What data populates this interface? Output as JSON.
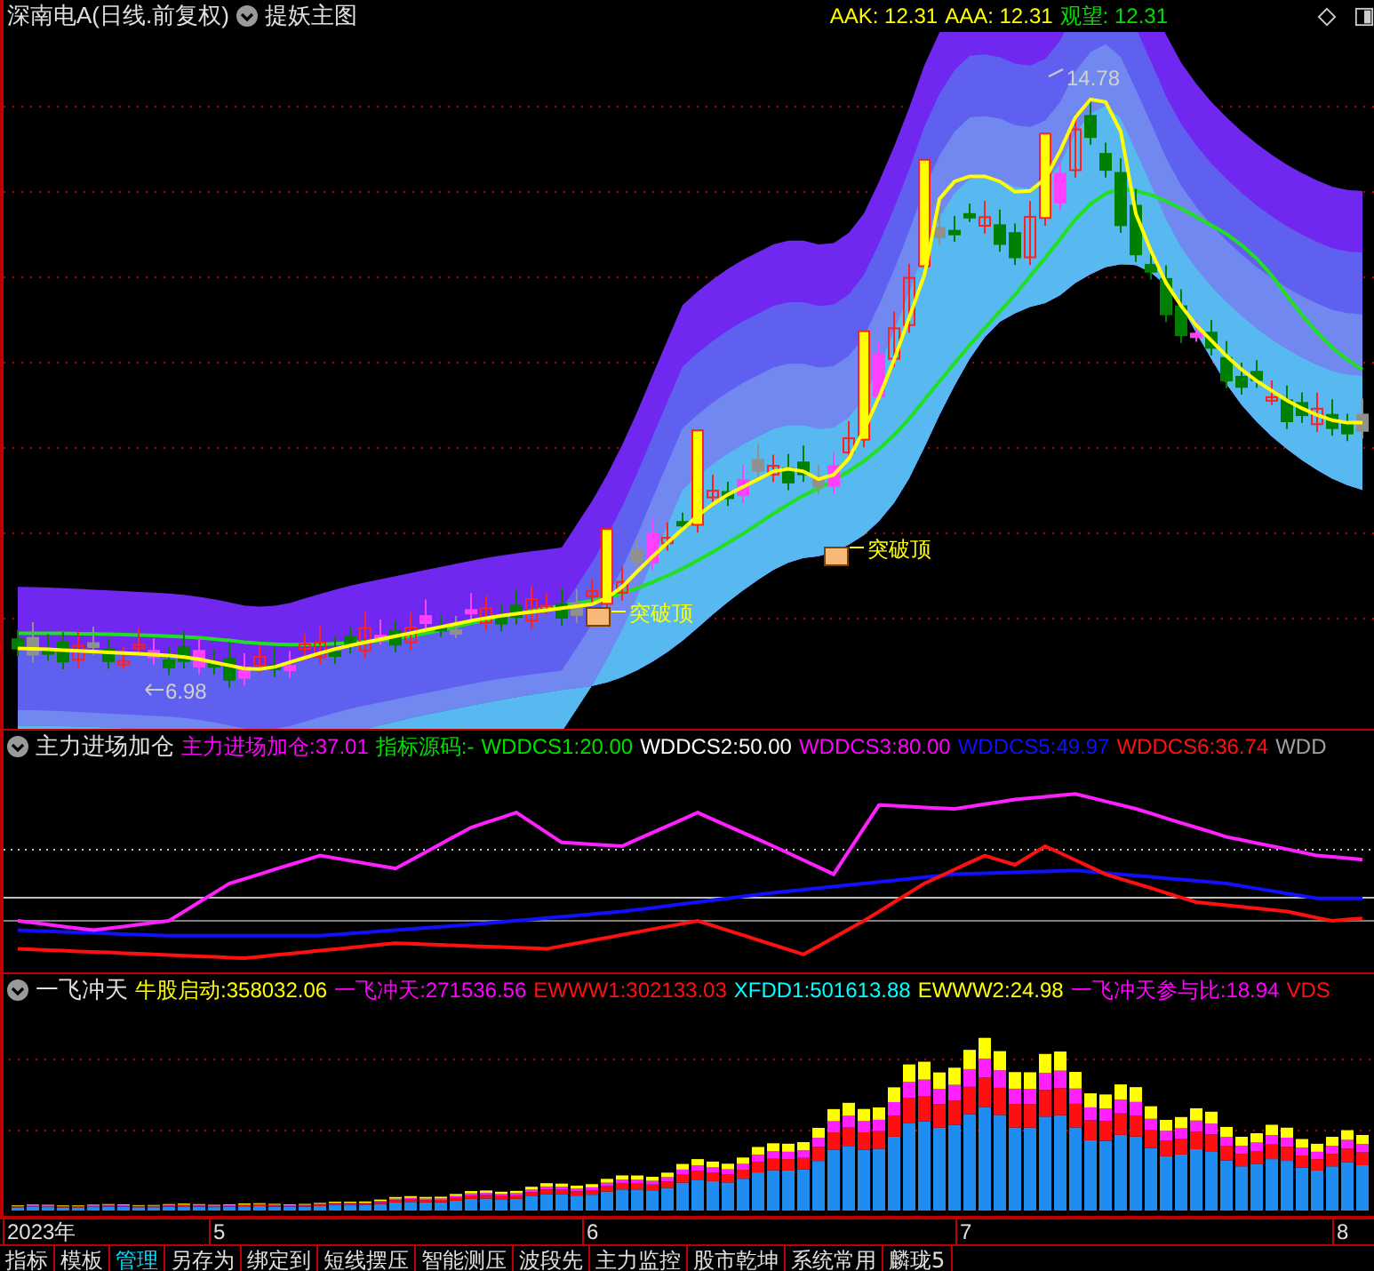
{
  "main_chart": {
    "title": "深南电A(日线.前复权)",
    "indicator": "提妖主图",
    "readings": [
      {
        "label": "AAK:",
        "value": "12.31",
        "color": "#ffff00"
      },
      {
        "label": "AAA:",
        "value": "12.31",
        "color": "#ffff00"
      },
      {
        "label": "观望:",
        "value": "12.31",
        "color": "#00e000"
      }
    ],
    "high_label": "14.78",
    "low_label": "6.98",
    "signals": [
      "突破顶",
      "突破顶"
    ]
  },
  "sub_chart_1": {
    "title": "主力进场加仓",
    "readings": [
      {
        "label": "主力进场加仓:",
        "value": "37.01",
        "color": "#ff00ff"
      },
      {
        "label": "指标源码:",
        "value": "-",
        "color": "#00e000"
      },
      {
        "label": "WDDCS1:",
        "value": "20.00",
        "color": "#00e000"
      },
      {
        "label": "WDDCS2:",
        "value": "50.00",
        "color": "#ffffff"
      },
      {
        "label": "WDDCS3:",
        "value": "80.00",
        "color": "#ff00ff"
      },
      {
        "label": "WDDCS5:",
        "value": "49.97",
        "color": "#1010ff"
      },
      {
        "label": "WDDCS6:",
        "value": "36.74",
        "color": "#ff1010"
      },
      {
        "label": "WDD",
        "color": "#a0a0a0"
      }
    ]
  },
  "sub_chart_2": {
    "title": "一飞冲天",
    "readings": [
      {
        "label": "牛股启动:",
        "value": "358032.06",
        "color": "#ffff00"
      },
      {
        "label": "一飞冲天:",
        "value": "271536.56",
        "color": "#ff00ff"
      },
      {
        "label": "EWWW1:",
        "value": "302133.03",
        "color": "#ff1010"
      },
      {
        "label": "XFDD1:",
        "value": "501613.88",
        "color": "#00ffff"
      },
      {
        "label": "EWWW2:",
        "value": "24.98",
        "color": "#ffff00"
      },
      {
        "label": "一飞冲天参与比:",
        "value": "18.94",
        "color": "#ff00ff"
      },
      {
        "label": "VDS",
        "color": "#ff1010"
      }
    ]
  },
  "date_axis": [
    "2023年",
    "5",
    "6",
    "7",
    "8"
  ],
  "tabs": [
    {
      "label": "指标",
      "selected": false
    },
    {
      "label": "模板",
      "selected": false
    },
    {
      "label": "管理",
      "selected": true
    },
    {
      "label": "另存为",
      "selected": false
    },
    {
      "label": "绑定到",
      "selected": false
    },
    {
      "label": "短线摆压",
      "selected": false
    },
    {
      "label": "智能测压",
      "selected": false
    },
    {
      "label": "波段先",
      "selected": false
    },
    {
      "label": "主力监控",
      "selected": false
    },
    {
      "label": "股市乾坤",
      "selected": false
    },
    {
      "label": "系统常用",
      "selected": false
    },
    {
      "label": "麟珑5",
      "selected": false
    }
  ]
}
